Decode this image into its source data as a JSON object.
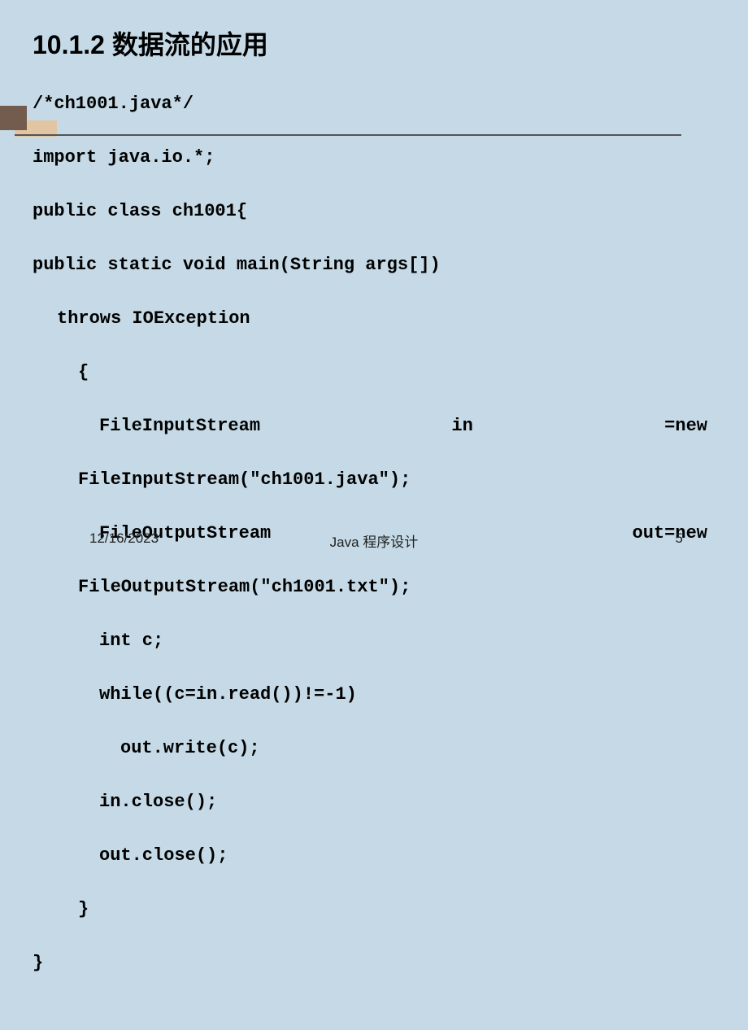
{
  "heading": {
    "section": "10.1.2",
    "title": "数据流的应用"
  },
  "code": {
    "line1": "/*ch1001.java*/",
    "line2": "import java.io.*;",
    "line3": "public class ch1001{",
    "line4": "public static void main(String args[])",
    "line5": "throws IOException",
    "line6": "{",
    "line7a": "FileInputStream",
    "line7b": "in",
    "line7c": "=new",
    "line8": "FileInputStream(\"ch1001.java\");",
    "line9a": "FileOutputStream",
    "line9b": "out=new",
    "line10": "FileOutputStream(\"ch1001.txt\");",
    "line11": "int c;",
    "line12": "while((c=in.read())!=-1)",
    "line13": "out.write(c);",
    "line14": "in.close();",
    "line15": "out.close();",
    "line16": "}",
    "line17": "}"
  },
  "footer": {
    "date": "12/16/2023",
    "title": "Java 程序设计",
    "page": "5"
  }
}
